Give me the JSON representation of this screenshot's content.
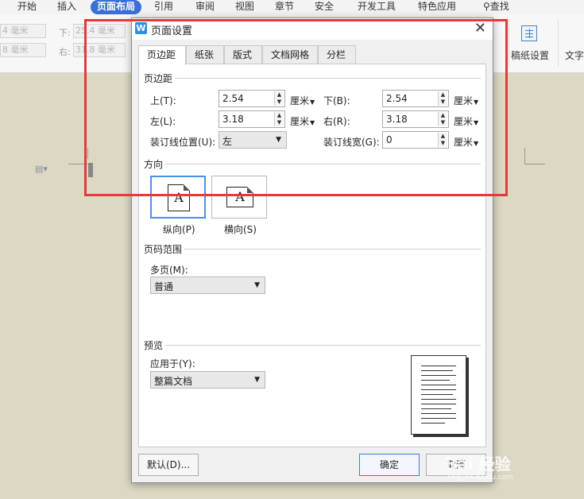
{
  "ribbon": {
    "tabs": [
      "开始",
      "插入",
      "页面布局",
      "引用",
      "审阅",
      "视图",
      "章节",
      "安全",
      "开发工具",
      "特色应用"
    ],
    "active_tab": "页面布局",
    "search_label": "查找",
    "margin_top_partial": "4 毫米",
    "margin_bottom_label": "下:",
    "margin_bottom_partial": "25.4 毫米",
    "margin_left_partial": "8 毫米",
    "margin_right_label": "右:",
    "margin_right_partial": "31.8 毫米",
    "paper_settings_label": "稿纸设置",
    "text_label": "文字"
  },
  "dialog": {
    "title": "页面设置",
    "tabs": [
      "页边距",
      "纸张",
      "版式",
      "文档网格",
      "分栏"
    ],
    "active_tab": "页边距",
    "margins": {
      "section_title": "页边距",
      "top_label": "上(T):",
      "top_value": "2.54",
      "bottom_label": "下(B):",
      "bottom_value": "2.54",
      "left_label": "左(L):",
      "left_value": "3.18",
      "right_label": "右(R):",
      "right_value": "3.18",
      "unit": "厘米",
      "gutter_pos_label": "装订线位置(U):",
      "gutter_pos_value": "左",
      "gutter_width_label": "装订线宽(G):",
      "gutter_width_value": "0"
    },
    "orientation": {
      "section_title": "方向",
      "portrait_label": "纵向(P)",
      "landscape_label": "横向(S)",
      "selected": "portrait",
      "icon_glyph": "A"
    },
    "page_range": {
      "section_title": "页码范围",
      "multi_label": "多页(M):",
      "multi_value": "普通"
    },
    "preview": {
      "section_title": "预览",
      "apply_label": "应用于(Y):",
      "apply_value": "整篇文档"
    },
    "buttons": {
      "default": "默认(D)...",
      "ok": "确定",
      "cancel": "取消"
    }
  },
  "watermark": {
    "text": "Bai 经验",
    "sub": "jingyan.baidu.com"
  },
  "colors": {
    "highlight": "#e43a3a",
    "active_tab": "#3a6fd8",
    "document_bg": "#ddd8c3"
  }
}
